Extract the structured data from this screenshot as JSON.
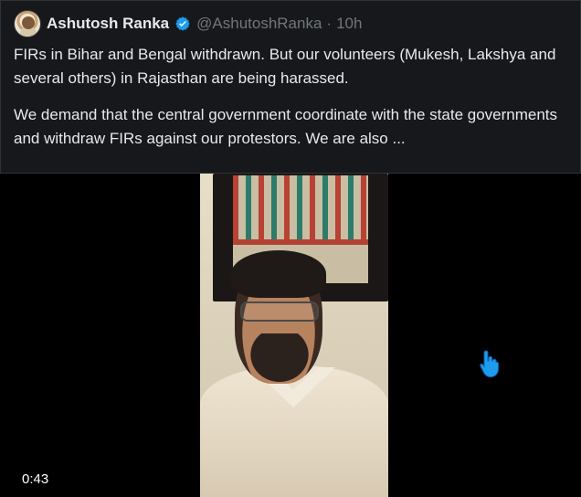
{
  "tweet": {
    "author_name": "Ashutosh Ranka",
    "handle": "@AshutoshRanka",
    "separator": "·",
    "time_ago": "10h",
    "paragraph_1": "FIRs in Bihar and Bengal withdrawn. But our volunteers (Mukesh, Lakshya and several others) in Rajasthan are being harassed.",
    "paragraph_2": "We demand that the central government coordinate with the state governments and withdraw FIRs against our protestors. We are also ..."
  },
  "video": {
    "duration": "0:43"
  },
  "icons": {
    "verified": "verified-badge-icon",
    "cursor": "hand-pointer-icon"
  },
  "colors": {
    "accent": "#1d9bf0",
    "card_bg": "#16181c",
    "muted_text": "#71767b"
  }
}
